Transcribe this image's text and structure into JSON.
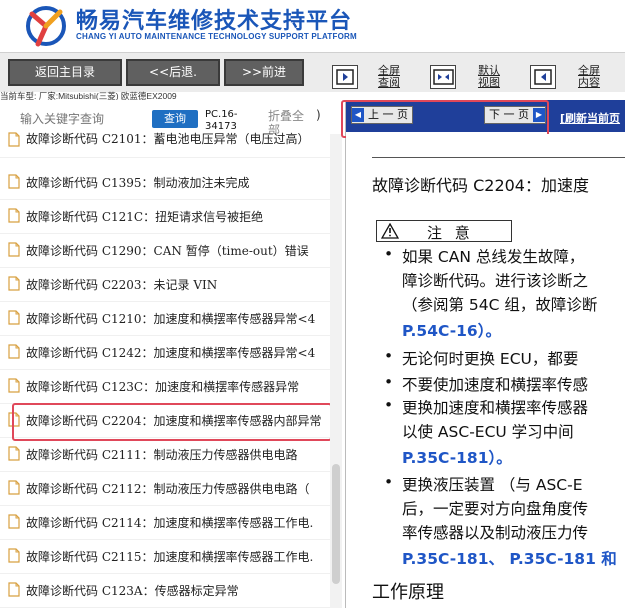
{
  "header": {
    "title": "畅易汽车维修技术支持平台",
    "subtitle": "CHANG YI AUTO MAINTENANCE TECHNOLOGY SUPPORT PLATFORM",
    "logo_icon": "cy-logo-icon",
    "brand_color": "#1a56b8"
  },
  "toolbar": {
    "back_main": "返回主目录",
    "back": "<<后退.",
    "forward": ">>前进",
    "views": [
      {
        "label": "全屏     查阅",
        "line1": "全屏",
        "line2": "查阅"
      },
      {
        "label": "默认视图",
        "line1": "默认",
        "line2": "视图"
      },
      {
        "label": "全屏内容",
        "line1": "全屏",
        "line2": "内容"
      }
    ]
  },
  "vehicle": "当前车型:  厂家:Mitsubishi(三菱) 欧蓝德EX2009",
  "search": {
    "placeholder": "输入关键字查询",
    "button": "查询",
    "page_ref": "PC.16-34173",
    "collapse": "折叠全部",
    "paren": ")"
  },
  "list": {
    "items": [
      "故障诊断代码 C2101：蓄电池电压异常（电压过高）",
      "故障诊断代码 C1395：制动液加注未完成",
      "故障诊断代码 C121C：扭矩请求信号被拒绝",
      "故障诊断代码 C1290：CAN 暂停（time-out）错误",
      "故障诊断代码 C2203：未记录 VIN",
      "故障诊断代码 C1210：加速度和横摆率传感器异常<4",
      "故障诊断代码 C1242：加速度和横摆率传感器异常<4",
      "故障诊断代码 C123C：加速度和横摆率传感器异常",
      "故障诊断代码 C2204：加速度和横摆率传感器内部异常",
      "故障诊断代码 C2111：制动液压力传感器供电电路",
      "故障诊断代码 C2112：制动液压力传感器供电电路（",
      "故障诊断代码 C2114：加速度和横摆率传感器工作电.",
      "故障诊断代码 C2115：加速度和横摆率传感器工作电.",
      "故障诊断代码 C123A：传感器标定异常"
    ],
    "selected_index": 8
  },
  "doc": {
    "prev": "上 一 页",
    "next": "下 一 页",
    "refresh": "[刷新当前页",
    "title": "故障诊断代码 C2204：加速度",
    "caution": "注 意",
    "lines": [
      {
        "text": "如果 CAN 总线发生故障，",
        "bullet": true
      },
      {
        "text": "障诊断代码。进行该诊断之",
        "bullet": false
      },
      {
        "text": "（参阅第 54C 组，故障诊断",
        "bullet": false
      },
      {
        "text": "P.54C-16）。",
        "bullet": false,
        "link": "P.54C-16"
      },
      {
        "text": "无论何时更换 ECU，都要",
        "bullet": true
      },
      {
        "text": "不要使加速度和横摆率传感",
        "bullet": true
      },
      {
        "text": "更换加速度和横摆率传感器",
        "bullet": true
      },
      {
        "text": "以使 ASC-ECU 学习中间",
        "bullet": false
      },
      {
        "text": "P.35C-181）。",
        "bullet": false,
        "link": "P.35C-181"
      },
      {
        "text": "更换液压装置 （与 ASC-E",
        "bullet": true
      },
      {
        "text": "后，一定要对方向盘角度传",
        "bullet": false
      },
      {
        "text": "率传感器以及制动液压力传",
        "bullet": false
      },
      {
        "text": "P.35C-181、 P.35C-181 和",
        "bullet": false,
        "link": "P.35C-181、 P.35C-181"
      }
    ],
    "section": "工作原理",
    "link_color": "#1f56c6",
    "bar_color": "#1f3f9a"
  },
  "highlight_color": "#e0485a"
}
